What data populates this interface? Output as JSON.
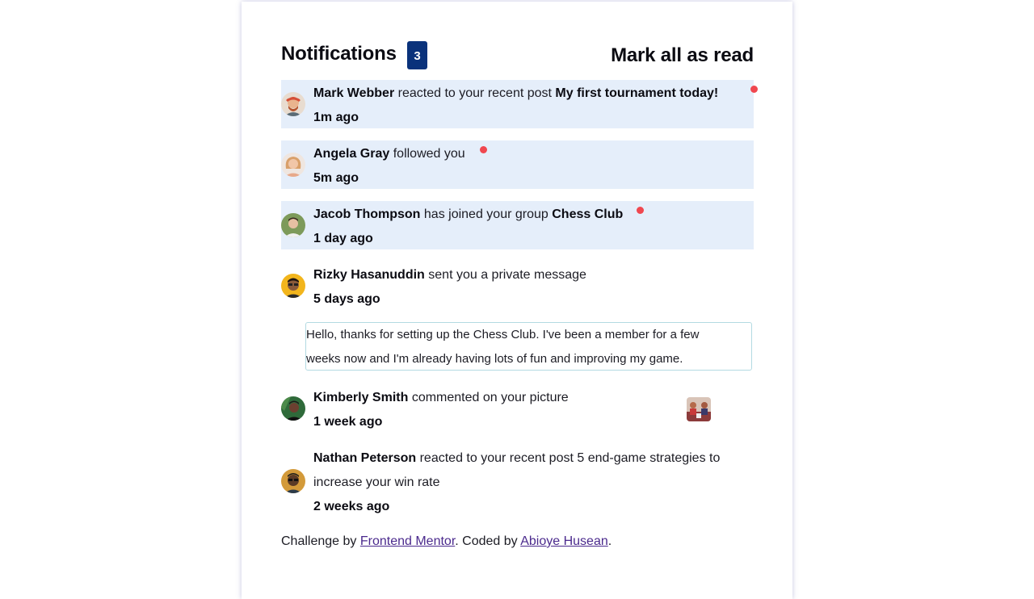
{
  "header": {
    "title": "Notifications",
    "badge_count": "3",
    "mark_all_label": "Mark all as read"
  },
  "notifications": [
    {
      "name": "Mark Webber",
      "action": "reacted to your recent post",
      "target": "My first tournament today!",
      "time": "1m ago",
      "unread": true
    },
    {
      "name": "Angela Gray",
      "action": "followed you",
      "target": "",
      "time": "5m ago",
      "unread": true
    },
    {
      "name": "Jacob Thompson",
      "action": "has joined your group",
      "target": "Chess Club",
      "time": "1 day ago",
      "unread": true
    },
    {
      "name": "Rizky Hasanuddin",
      "action": "sent you a private message",
      "target": "",
      "time": "5 days ago",
      "unread": false,
      "message_line1": "Hello, thanks for setting up the Chess Club. I've been a member for a few",
      "message_line2": "weeks now and I'm already having lots of fun and improving my game."
    },
    {
      "name": "Kimberly Smith",
      "action": "commented on your picture",
      "target": "",
      "time": "1 week ago",
      "unread": false
    },
    {
      "name": "Nathan Peterson",
      "action": "reacted to your recent post 5 end-game strategies to",
      "action_line2": "increase your win rate",
      "target": "",
      "time": "2 weeks ago",
      "unread": false
    }
  ],
  "footer": {
    "prefix": "Challenge by",
    "link1": "Frontend Mentor",
    "middle": ". Coded by",
    "link2": "Abioye Husean",
    "suffix": "."
  },
  "colors": {
    "unread_bg": "#e5eefa",
    "badge_bg": "#0a327b",
    "dot": "#f0474f",
    "link": "#4b2a8d",
    "message_border": "#b3dae2"
  },
  "icons": [
    "avatar-mark-webber",
    "avatar-angela-gray",
    "avatar-jacob-thompson",
    "avatar-rizky-hasanuddin",
    "avatar-kimberly-smith",
    "avatar-nathan-peterson",
    "chess-picture-thumbnail",
    "unread-dot"
  ]
}
